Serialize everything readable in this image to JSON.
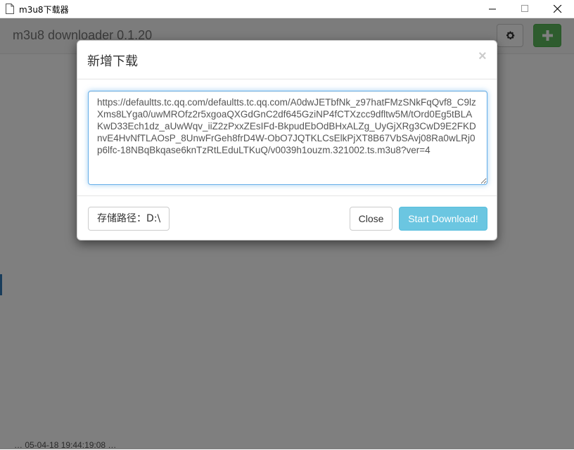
{
  "window": {
    "title": "m3u8下载器"
  },
  "app": {
    "title": "m3u8 downloader  0.1.20",
    "background_row_text": "… 05-04-18 19:44:19:08 …",
    "colors": {
      "add_button": "#5cb85c",
      "primary": "#337ab7"
    }
  },
  "modal": {
    "title": "新增下载",
    "close_x": "×",
    "url_value": "https://defaultts.tc.qq.com/defaultts.tc.qq.com/A0dwJETbfNk_z97hatFMzSNkFqQvf8_C9lzXms8LYga0/uwMROfz2r5xgoaQXGdGnC2df645GziNP4fCTXzcc9dfltw5M/tOrd0Eg5tBLAKwD33Ech1dz_aUwWqv_iiZ2zPxxZEsIFd-BkpudEbOdBHxALZg_UyGjXRg3CwD9E2FKDnvE4HvNfTLAOsP_8UnwFrGeh8frD4W-ObO7JQTKLCsElkPjXT8B67VbSAvj08Ra0wLRj0p6lfc-18NBqBkqase6knTzRtLEduLTKuQ/v0039h1ouzm.321002.ts.m3u8?ver=4",
    "path_label": "存储路径：D:\\",
    "close_label": "Close",
    "start_label": "Start Download!",
    "colors": {
      "start_button": "#5bc0de"
    }
  }
}
